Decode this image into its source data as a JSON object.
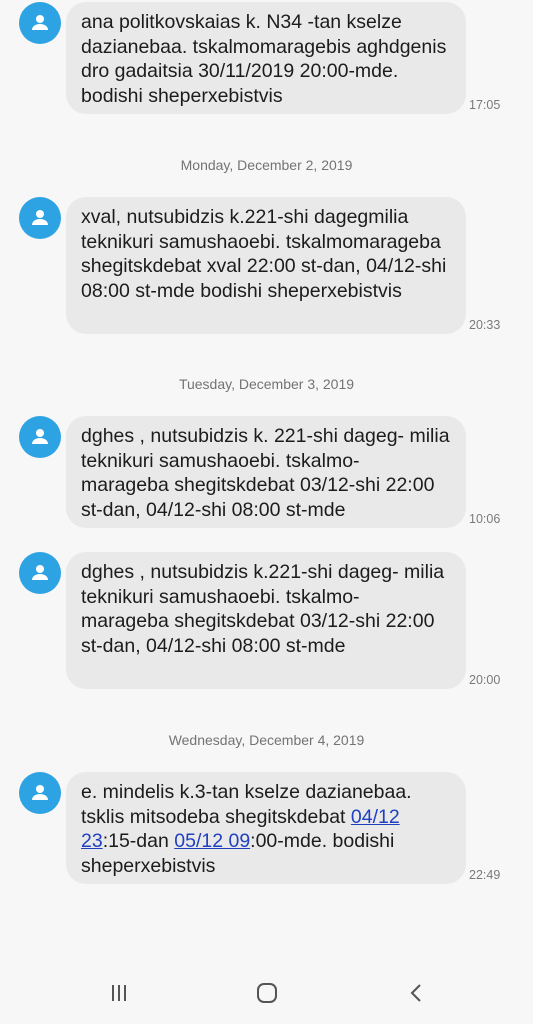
{
  "messages": [
    {
      "text": "ana politkovskaias k. N34 -tan kselze dazianebaa. tskalmomaragebis aghdgenis dro gadaitsia 30/11/2019 20:00-mde. bodishi sheperxebistvis",
      "time": "17:05"
    },
    {
      "date": "Monday, December 2, 2019",
      "text": "xval, nutsubidzis k.221-shi dagegmilia teknikuri samushaoebi. tskalmomarageba shegitskdebat xval 22:00 st-dan, 04/12-shi 08:00 st-mde bodishi sheperxebistvis",
      "time": "20:33"
    },
    {
      "date": "Tuesday, December 3, 2019",
      "text": "dghes , nutsubidzis k. 221-shi dageg- milia teknikuri samushaoebi. tskalmo- marageba shegitskdebat 03/12-shi 22:00 st-dan, 04/12-shi 08:00 st-mde",
      "time": "10:06"
    },
    {
      "text": "dghes , nutsubidzis k.221-shi dageg- milia teknikuri samushaoebi. tskalmo- marageba shegitskdebat 03/12-shi 22:00 st-dan, 04/12-shi 08:00 st-mde",
      "time": "20:00"
    },
    {
      "date": "Wednesday, December 4, 2019",
      "text_a": "e. mindelis k.3-tan kselze dazianebaa. tsklis mitsodeba shegitskdebat ",
      "link1": "04/12 23",
      "text_b": ":15-dan ",
      "link2": "05/12 09",
      "text_c": ":00-mde. bodishi sheperxebistvis",
      "time": "22:49"
    }
  ],
  "navbar": {
    "icons": [
      "recent-apps-icon",
      "home-icon",
      "back-icon"
    ]
  },
  "colors": {
    "avatar": "#2ea3e3",
    "bubble": "#e9e9e9",
    "link": "#2040c0",
    "background": "#f7f7f7"
  }
}
